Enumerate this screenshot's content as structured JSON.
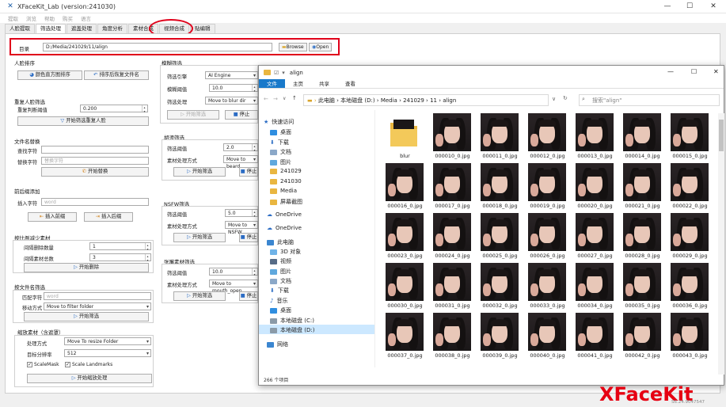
{
  "window": {
    "title": "XFaceKit_Lab (version:241030)"
  },
  "menu": [
    "提取",
    "浏览",
    "帮助",
    "购买",
    "语言"
  ],
  "tabs": [
    "人脸提取",
    "筛选处理",
    "遮盖处理",
    "角度分析",
    "素材合成",
    "视频合成",
    "贴编辑"
  ],
  "dir": {
    "label": "目录",
    "value": "D:/Media/241029/11/align",
    "browse": "Browse",
    "open": "Open"
  },
  "left": {
    "sort": {
      "title": "人脸排序",
      "btn_hist": "颜色直方图排序",
      "btn_restore": "排序后恢复文件名"
    },
    "dup": {
      "title": "重复人脸筛选",
      "threshold_label": "重复判断阈值",
      "threshold": "0.200",
      "btn": "开始筛选重复人脸"
    },
    "rename": {
      "title": "文件名替换",
      "find_label": "查找字符",
      "replace_label": "替换字符",
      "replace_ph": "替换字符",
      "btn": "开始替换"
    },
    "prefix": {
      "title": "前后缀添加",
      "insert_label": "插入字符",
      "insert_ph": "word",
      "btn_prefix": "插入前缀",
      "btn_suffix": "插入后缀"
    },
    "reduce": {
      "title": "按比例减少素材",
      "del_label": "间隔删除数量",
      "del_val": "1",
      "keep_label": "间隔素材总数",
      "keep_val": "3",
      "btn": "开始删除"
    },
    "filter": {
      "title": "按文件名筛选",
      "match_label": "匹配字符",
      "match_ph": "word",
      "move_label": "移动方式",
      "move_val": "Move to filter folder",
      "btn": "开始筛选"
    },
    "scale": {
      "title": "缩放素材（含遮罩）",
      "mode_label": "处理方式",
      "mode_val": "Move To resize Folder",
      "res_label": "目标分辨率",
      "res_val": "512",
      "chk1": "ScaleMask",
      "chk2": "Scale Landmarks",
      "btn": "开始缩放处理"
    }
  },
  "mid": {
    "blur": {
      "title": "模糊筛选",
      "engine_label": "筛选引擎",
      "engine_val": "AI Engine",
      "thr_label": "模糊阈值",
      "thr_val": "10.0",
      "proc_label": "筛选处理",
      "proc_val": "Move to blur dir",
      "btn_start": "开始筛选",
      "btn_stop": "停止"
    },
    "beard": {
      "title": "胡须筛选",
      "thr_label": "筛选阈值",
      "thr_val": "2.0",
      "proc_label": "素材处理方式",
      "proc_val": "Move to beard",
      "btn_start": "开始筛选",
      "btn_stop": "停止"
    },
    "nsfw": {
      "title": "NSFW筛选",
      "thr_label": "筛选阈值",
      "thr_val": "5.0",
      "proc_label": "素材处理方式",
      "proc_val": "Move to NSFW",
      "btn_start": "开始筛选",
      "btn_stop": "停止"
    },
    "mouth": {
      "title": "张嘴素材筛选",
      "thr_label": "筛选阈值",
      "thr_val": "10.0",
      "proc_label": "素材处理方式",
      "proc_val": "Move to mouth_open",
      "btn_start": "开始筛选",
      "btn_stop": "停止"
    }
  },
  "explorer": {
    "title": "align",
    "ribbon": [
      "文件",
      "主页",
      "共享",
      "查看"
    ],
    "path": [
      "此电脑",
      "本地磁盘 (D:)",
      "Media",
      "241029",
      "11",
      "align"
    ],
    "search_ph": "搜索\"align\"",
    "nav": [
      "快速访问",
      "桌面",
      "下载",
      "文档",
      "图片",
      "241029",
      "241030",
      "Media",
      "屏幕截图",
      "OneDrive",
      "OneDrive",
      "此电脑",
      "3D 对象",
      "视频",
      "图片",
      "文档",
      "下载",
      "音乐",
      "桌面",
      "本地磁盘 (C:)",
      "本地磁盘 (D:)",
      "网络"
    ],
    "files": [
      "blur",
      "000010_0.jpg",
      "000011_0.jpg",
      "000012_0.jpg",
      "000013_0.jpg",
      "000014_0.jpg",
      "000015_0.jpg",
      "000016_0.jpg",
      "000017_0.jpg",
      "000018_0.jpg",
      "000019_0.jpg",
      "000020_0.jpg",
      "000021_0.jpg",
      "000022_0.jpg",
      "000023_0.jpg",
      "000024_0.jpg",
      "000025_0.jpg",
      "000026_0.jpg",
      "000027_0.jpg",
      "000028_0.jpg",
      "000029_0.jpg",
      "000030_0.jpg",
      "000031_0.jpg",
      "000032_0.jpg",
      "000033_0.jpg",
      "000034_0.jpg",
      "000035_0.jpg",
      "000036_0.jpg",
      "000037_0.jpg",
      "000038_0.jpg",
      "000039_0.jpg",
      "000040_0.jpg",
      "000041_0.jpg",
      "000042_0.jpg",
      "000043_0.jpg"
    ],
    "status": "266 个项目"
  },
  "brand": "XFaceKit",
  "version_text": "S6.24.9047547"
}
